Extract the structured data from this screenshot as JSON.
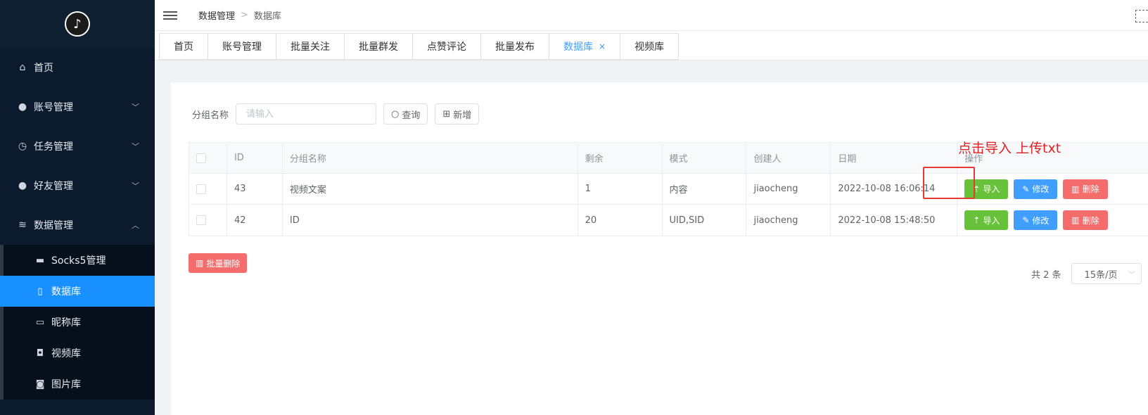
{
  "sidebar": {
    "logo_icon": "tiktok-logo",
    "items": [
      {
        "label": "首页",
        "icon": "home-icon"
      },
      {
        "label": "账号管理",
        "icon": "user-icon"
      },
      {
        "label": "任务管理",
        "icon": "timer-icon"
      },
      {
        "label": "好友管理",
        "icon": "user-icon"
      },
      {
        "label": "数据管理",
        "icon": "database-icon"
      }
    ],
    "sub_items": [
      {
        "label": "Socks5管理",
        "icon": "monitor-icon"
      },
      {
        "label": "数据库",
        "icon": "tablet-icon",
        "active": true
      },
      {
        "label": "昵称库",
        "icon": "box-icon"
      },
      {
        "label": "视频库",
        "icon": "camera-icon"
      },
      {
        "label": "图片库",
        "icon": "photo-icon"
      }
    ]
  },
  "header": {
    "breadcrumb": [
      "数据管理",
      "数据库"
    ]
  },
  "tags": [
    {
      "label": "首页"
    },
    {
      "label": "账号管理"
    },
    {
      "label": "批量关注"
    },
    {
      "label": "批量群发"
    },
    {
      "label": "点赞评论"
    },
    {
      "label": "批量发布"
    },
    {
      "label": "数据库",
      "active": true
    },
    {
      "label": "视频库"
    }
  ],
  "search": {
    "label": "分组名称",
    "placeholder": "请输入",
    "query_label": "查询",
    "add_label": "新增"
  },
  "table": {
    "columns": [
      "ID",
      "分组名称",
      "剩余",
      "模式",
      "创建人",
      "日期",
      "操作"
    ],
    "rows": [
      {
        "id": "43",
        "name": "视频文案",
        "remaining": "1",
        "mode": "内容",
        "creator": "jiaocheng",
        "date": "2022-10-08 16:06:14"
      },
      {
        "id": "42",
        "name": "ID",
        "remaining": "20",
        "mode": "UID,SID",
        "creator": "jiaocheng",
        "date": "2022-10-08 15:48:50"
      }
    ],
    "actions": {
      "import": "导入",
      "edit": "修改",
      "delete": "删除"
    }
  },
  "annotation": "点击导入 上传txt",
  "batch_delete": "批量删除",
  "pager": {
    "total": "共 2 条",
    "page_size": "15条/页"
  },
  "colors": {
    "sidebar_bg": "#0b1a2c",
    "active": "#1890ff",
    "success": "#67c23a",
    "primary": "#409eff",
    "danger": "#f56c6c",
    "annotation": "#e02020"
  }
}
